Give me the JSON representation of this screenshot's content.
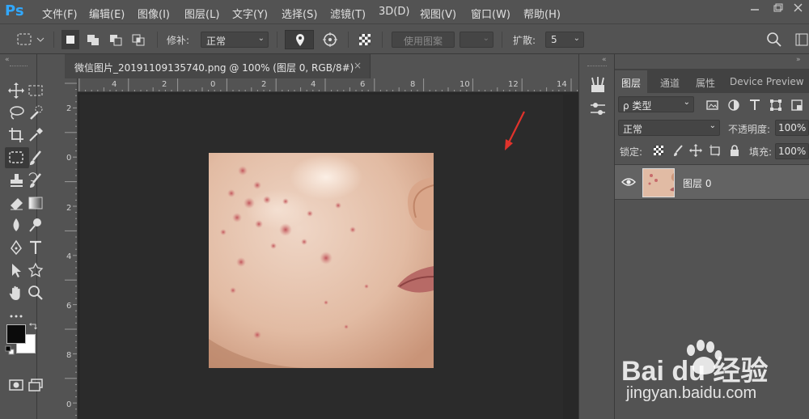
{
  "app": {
    "logo": "Ps"
  },
  "menu": [
    {
      "label": "文件(F)"
    },
    {
      "label": "编辑(E)"
    },
    {
      "label": "图像(I)"
    },
    {
      "label": "图层(L)"
    },
    {
      "label": "文字(Y)"
    },
    {
      "label": "选择(S)"
    },
    {
      "label": "滤镜(T)"
    },
    {
      "label": "3D(D)"
    },
    {
      "label": "视图(V)"
    },
    {
      "label": "窗口(W)"
    },
    {
      "label": "帮助(H)"
    }
  ],
  "options": {
    "repair_label": "修补:",
    "repair_mode": "正常",
    "use_pattern_label": "使用图案",
    "diffusion_label": "扩散:",
    "diffusion_value": "5"
  },
  "document": {
    "tab_title": "微信图片_20191109135740.png @ 100% (图层 0, RGB/8#)",
    "close_glyph": "×",
    "hruler_labels": [
      "4",
      "2",
      "0",
      "2",
      "4",
      "6",
      "8",
      "10",
      "12",
      "14"
    ],
    "vruler_labels": [
      "2",
      "0",
      "2",
      "4",
      "6",
      "8",
      "0"
    ]
  },
  "panel": {
    "tabs": [
      {
        "label": "图层",
        "active": true
      },
      {
        "label": "通道",
        "active": false
      },
      {
        "label": "属性",
        "active": false
      },
      {
        "label": "Device Preview",
        "active": false
      }
    ],
    "filter_kind": "ρ 类型",
    "blend_mode": "正常",
    "opacity_label": "不透明度:",
    "opacity_value": "100%",
    "lock_label": "锁定:",
    "fill_label": "填充:",
    "fill_value": "100%",
    "layers": [
      {
        "name": "图层 0",
        "visible": true
      }
    ]
  },
  "watermark": {
    "brand": "Bai du 经验",
    "url": "jingyan.baidu.com"
  },
  "colors": {
    "accent": "#31a8ff",
    "arrow": "#e0332c",
    "foreground": "#0b0b0b",
    "background": "#ffffff"
  }
}
